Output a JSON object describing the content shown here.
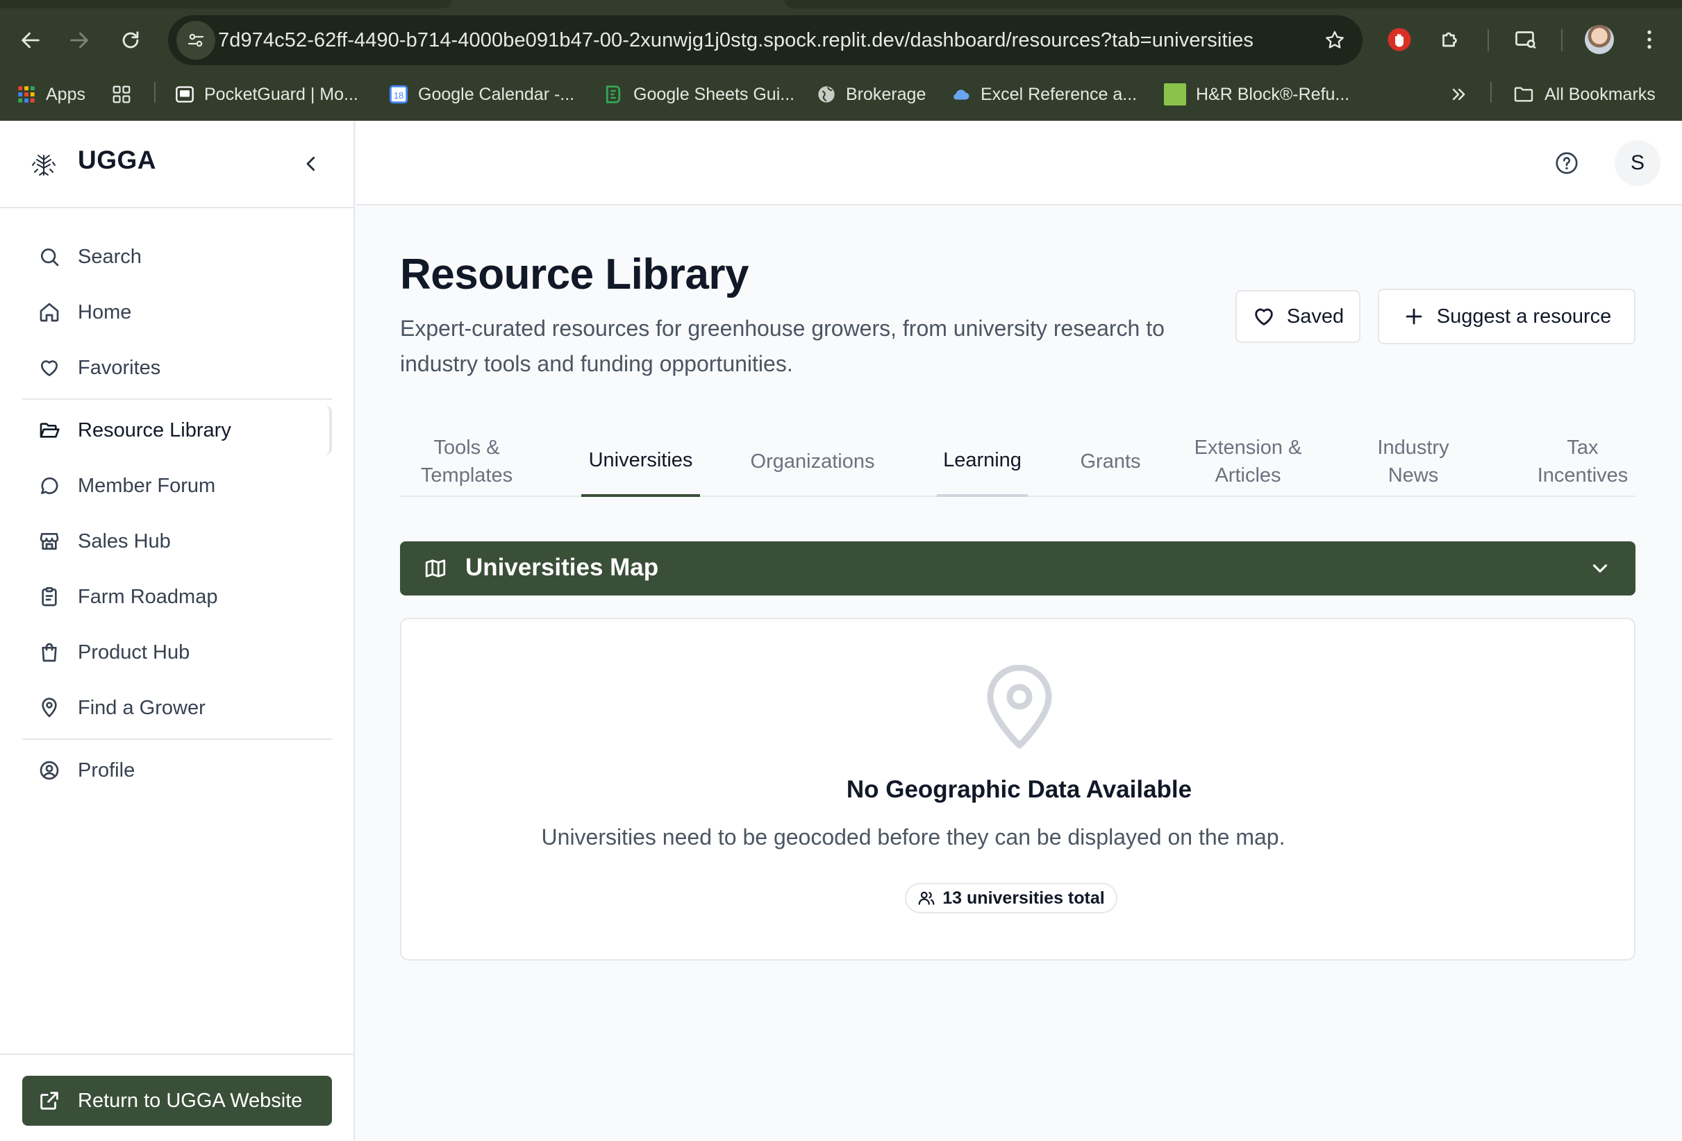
{
  "browser": {
    "url": "7d974c52-62ff-4490-b714-4000be091b47-00-2xunwjg1j0stg.spock.replit.dev/dashboard/resources?tab=universities",
    "bookmarks": [
      {
        "label": "Apps",
        "icon": "apps-grid-icon",
        "color": "#ea4335"
      },
      {
        "label": "PocketGuard | Mo...",
        "icon": "pocketguard-icon",
        "color": "#ffffff"
      },
      {
        "label": "Google Calendar -...",
        "icon": "google-calendar-icon",
        "color": "#4285f4"
      },
      {
        "label": "Google Sheets Gui...",
        "icon": "sheets-guide-icon",
        "color": "#34a853"
      },
      {
        "label": "Brokerage",
        "icon": "globe-icon",
        "color": "#c8ccc4"
      },
      {
        "label": "Excel Reference a...",
        "icon": "cloud-icon",
        "color": "#6aa6f0"
      },
      {
        "label": "H&R Block®-Refu...",
        "icon": "hr-block-icon",
        "color": "#8bc34a"
      }
    ],
    "all_bookmarks": "All Bookmarks"
  },
  "sidebar": {
    "brand": "UGGA",
    "items": [
      {
        "label": "Search",
        "icon": "search-icon"
      },
      {
        "label": "Home",
        "icon": "home-icon"
      },
      {
        "label": "Favorites",
        "icon": "heart-icon"
      },
      {
        "label": "Resource Library",
        "icon": "folder-open-icon",
        "active": true
      },
      {
        "label": "Member Forum",
        "icon": "chat-bubble-icon"
      },
      {
        "label": "Sales Hub",
        "icon": "store-icon"
      },
      {
        "label": "Farm Roadmap",
        "icon": "clipboard-icon"
      },
      {
        "label": "Product Hub",
        "icon": "shopping-bag-icon"
      },
      {
        "label": "Find a Grower",
        "icon": "map-pin-icon"
      },
      {
        "label": "Profile",
        "icon": "user-circle-icon"
      }
    ],
    "return_label": "Return to UGGA Website"
  },
  "topbar": {
    "avatar_initial": "S"
  },
  "main": {
    "title": "Resource Library",
    "subtitle": "Expert-curated resources for greenhouse growers, from university research to industry tools and funding opportunities.",
    "saved_label": "Saved",
    "suggest_label": "Suggest a resource",
    "tabs": [
      {
        "label": "Tools & Templates"
      },
      {
        "label": "Universities",
        "active": true
      },
      {
        "label": "Organizations"
      },
      {
        "label": "Learning"
      },
      {
        "label": "Grants"
      },
      {
        "label": "Extension & Articles"
      },
      {
        "label": "Industry News"
      },
      {
        "label": "Tax Incentives"
      }
    ],
    "map_section": {
      "title": "Universities Map"
    },
    "empty_state": {
      "title": "No Geographic Data Available",
      "description": "Universities need to be geocoded before they can be displayed on the map.",
      "badge": "13 universities total"
    }
  },
  "colors": {
    "chrome": "#333d2c",
    "brand_green": "#3a4f38",
    "text_primary": "#111827",
    "text_muted": "#4b5563"
  }
}
